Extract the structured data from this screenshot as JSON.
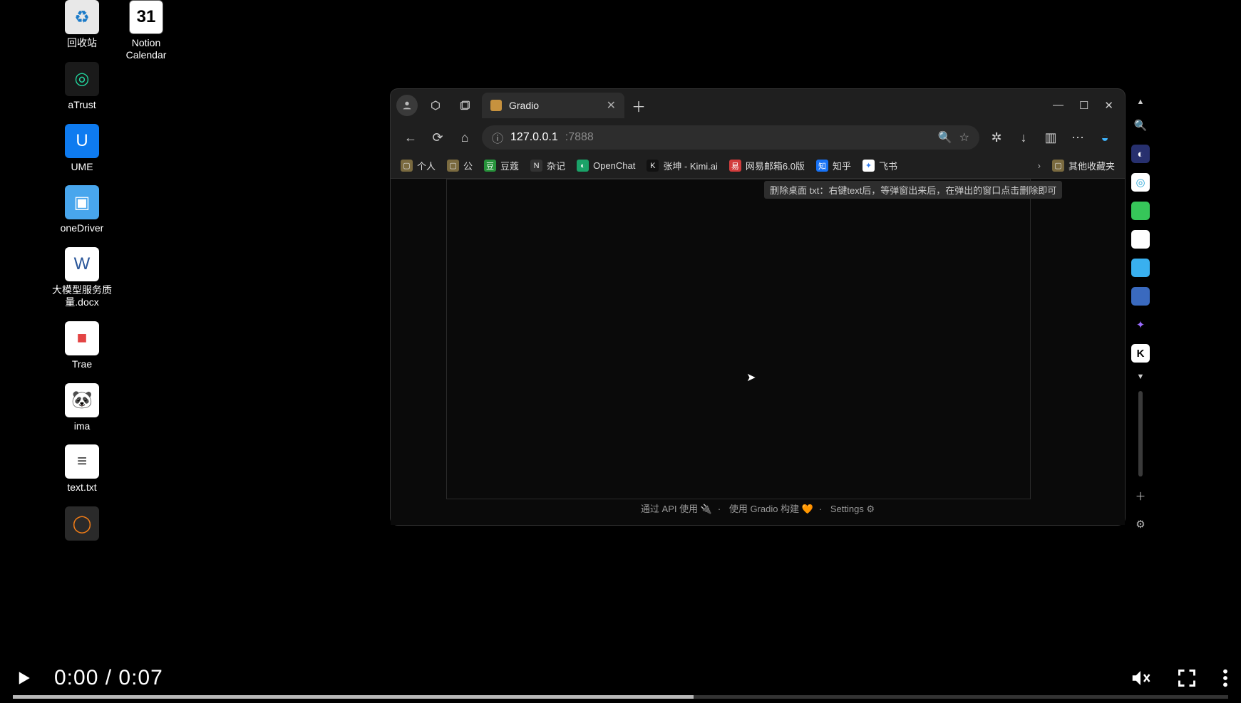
{
  "desktop": {
    "icons_col1": [
      {
        "label": "回收站",
        "glyph": "♻"
      },
      {
        "label": "aTrust",
        "glyph": "◎"
      },
      {
        "label": "UME",
        "glyph": "U"
      },
      {
        "label": "oneDriver",
        "glyph": "▣"
      },
      {
        "label": "大模型服务质量.docx",
        "glyph": "W"
      },
      {
        "label": "Trae",
        "glyph": "■"
      },
      {
        "label": "ima",
        "glyph": "🐼"
      },
      {
        "label": "text.txt",
        "glyph": "≡"
      },
      {
        "label": "",
        "glyph": "◯"
      }
    ],
    "icons_col2": [
      {
        "label": "Notion Calendar",
        "glyph": "31"
      }
    ]
  },
  "browser": {
    "tab_title": "Gradio",
    "url_host": "127.0.0.1",
    "url_port": ":7888",
    "bookmarks": [
      {
        "label": "个人",
        "color": "#c9a24a"
      },
      {
        "label": "公",
        "color": "#c9a24a"
      },
      {
        "label": "豆蔻",
        "color": "#27933b"
      },
      {
        "label": "杂记",
        "color": "#3a3a3a"
      },
      {
        "label": "OpenChat",
        "color": "#1aa268"
      },
      {
        "label": "张坤 - Kimi.ai",
        "color": "#111"
      },
      {
        "label": "网易邮箱6.0版",
        "color": "#d23c3c"
      },
      {
        "label": "知乎",
        "color": "#1772f6"
      },
      {
        "label": "飞书",
        "color": "#2f7bf0"
      }
    ],
    "bookmark_overflow": "其他收藏夹",
    "tooltip_text": "删除桌面 txt：右键text后，等弹窗出来后，在弹出的窗口点击删除即可",
    "footer": {
      "api": "通过 API 使用 🔌",
      "built": "使用 Gradio 构建 🧡",
      "settings": "Settings ⚙"
    }
  },
  "video": {
    "time_current": "0:00",
    "time_total": "0:07",
    "time_display": "0:00 / 0:07"
  }
}
